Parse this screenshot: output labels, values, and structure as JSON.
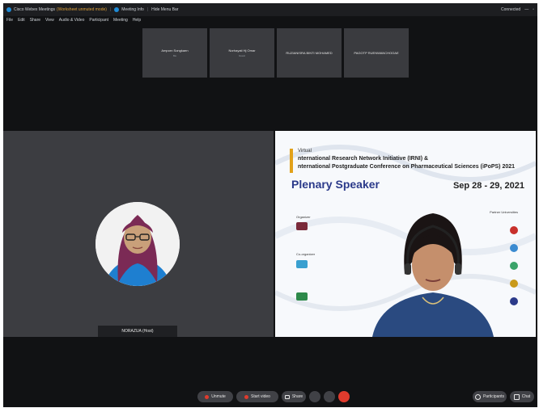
{
  "titlebar": {
    "app_name": "Cisco Webex Meetings",
    "warning": "(Worksheet unmuted mode)",
    "meeting_info": "Meeting Info",
    "hide_menu": "Hide Menu Bar",
    "connected": "Connected"
  },
  "menu": [
    "File",
    "Edit",
    "Share",
    "View",
    "Audio & Video",
    "Participant",
    "Meeting",
    "Help"
  ],
  "participants": [
    {
      "name": "Amporn Songkaen",
      "sub": "Me"
    },
    {
      "name": "Norhayati Hj Omar",
      "sub": "Guest"
    },
    {
      "name": "RUZIANISRA BINTI MOHAMED",
      "sub": ""
    },
    {
      "name": "PAGOTP RUENWANCHOOAE",
      "sub": ""
    }
  ],
  "host_label": "NORAZUA (Host)",
  "slide": {
    "virtual": "Virtual",
    "line1": "nternational Research Network Initiative (IRNI) &",
    "line2": "nternational Postgraduate Conference on Pharmaceutical Sciences (iPoPS) 2021",
    "title": "Plenary Speaker",
    "dates": "Sep 28 - 29, 2021",
    "organizer": "Organizer",
    "co_organizer": "Co-organizer",
    "partner": "Partner Universities"
  },
  "controls": {
    "unmute": "Unmute",
    "start_video": "Start video",
    "share": "Share",
    "participants": "Participants",
    "chat": "Chat"
  },
  "colors": {
    "end_call": "#e03b2d",
    "accent": "#1f8bd6",
    "slide_title": "#2b3a8a"
  }
}
